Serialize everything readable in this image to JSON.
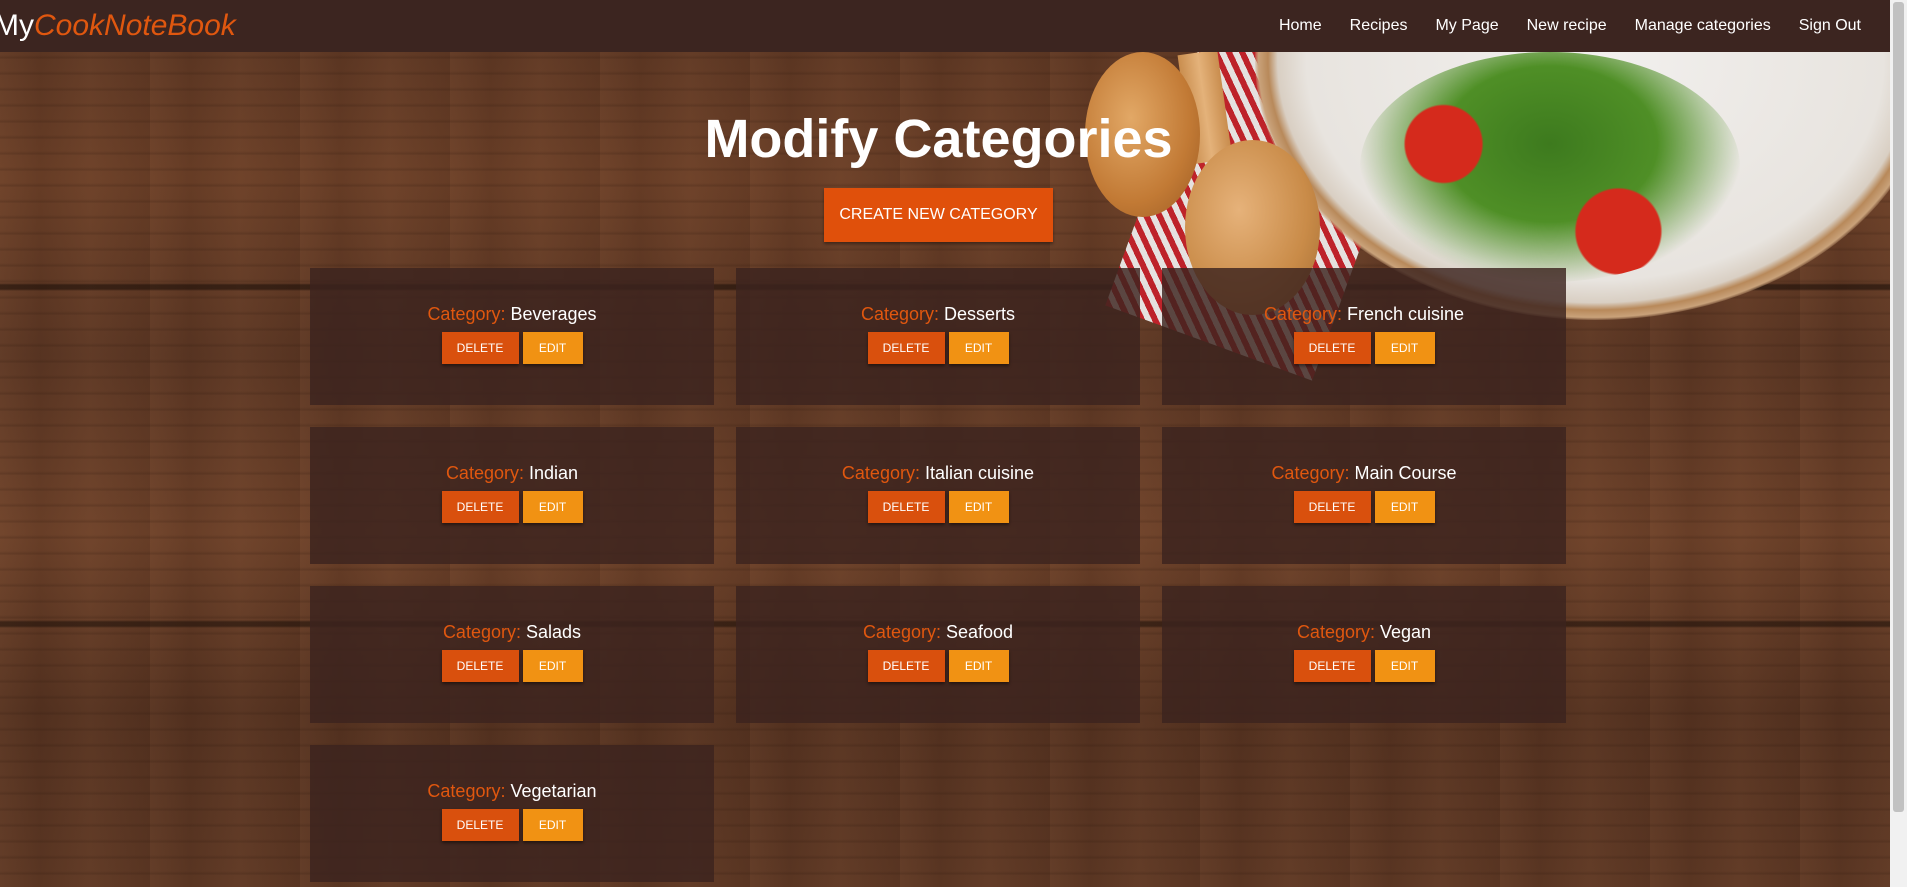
{
  "navbar": {
    "brand_prefix": "My",
    "brand_accent": "CookNoteBook",
    "links": [
      "Home",
      "Recipes",
      "My Page",
      "New recipe",
      "Manage categories",
      "Sign Out"
    ]
  },
  "page": {
    "title": "Modify Categories",
    "create_button": "CREATE NEW CATEGORY"
  },
  "card_label": "Category:",
  "delete_label": "DELETE",
  "edit_label": "EDIT",
  "categories": [
    "Beverages",
    "Desserts",
    "French cuisine",
    "Indian",
    "Italian cuisine",
    "Main Course",
    "Salads",
    "Seafood",
    "Vegan",
    "Vegetarian"
  ],
  "colors": {
    "accent": "#e0570f",
    "delete": "#d9500d",
    "edit": "#f19213",
    "navbar": "#3c2520"
  }
}
